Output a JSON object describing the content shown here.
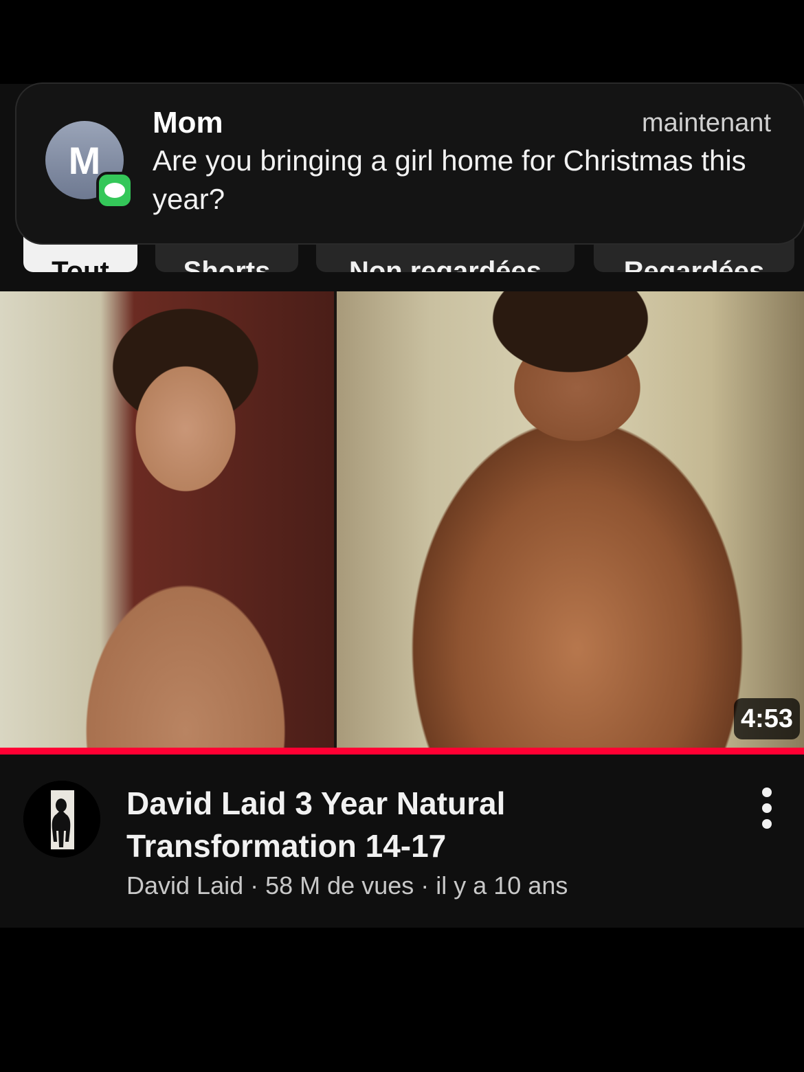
{
  "notification": {
    "avatar_letter": "M",
    "sender": "Mom",
    "time": "maintenant",
    "message": "Are you bringing a girl home for Christmas this year?",
    "app_icon": "messages-icon"
  },
  "chips": [
    {
      "label": "Tout",
      "active": true
    },
    {
      "label": "Shorts",
      "active": false
    },
    {
      "label": "Non regardées",
      "active": false
    },
    {
      "label": "Regardées",
      "active": false
    }
  ],
  "video": {
    "duration": "4:53",
    "watch_progress": 1.0,
    "title": "David Laid 3 Year Natural Transformation 14-17",
    "channel": "David Laid",
    "views": "58 M de vues",
    "age": "il y a 10 ans",
    "separator": " · ",
    "menu_icon": "more-vert-icon"
  },
  "colors": {
    "background": "#0f0f0f",
    "progress": "#ff0033",
    "messages_green": "#34c759"
  }
}
